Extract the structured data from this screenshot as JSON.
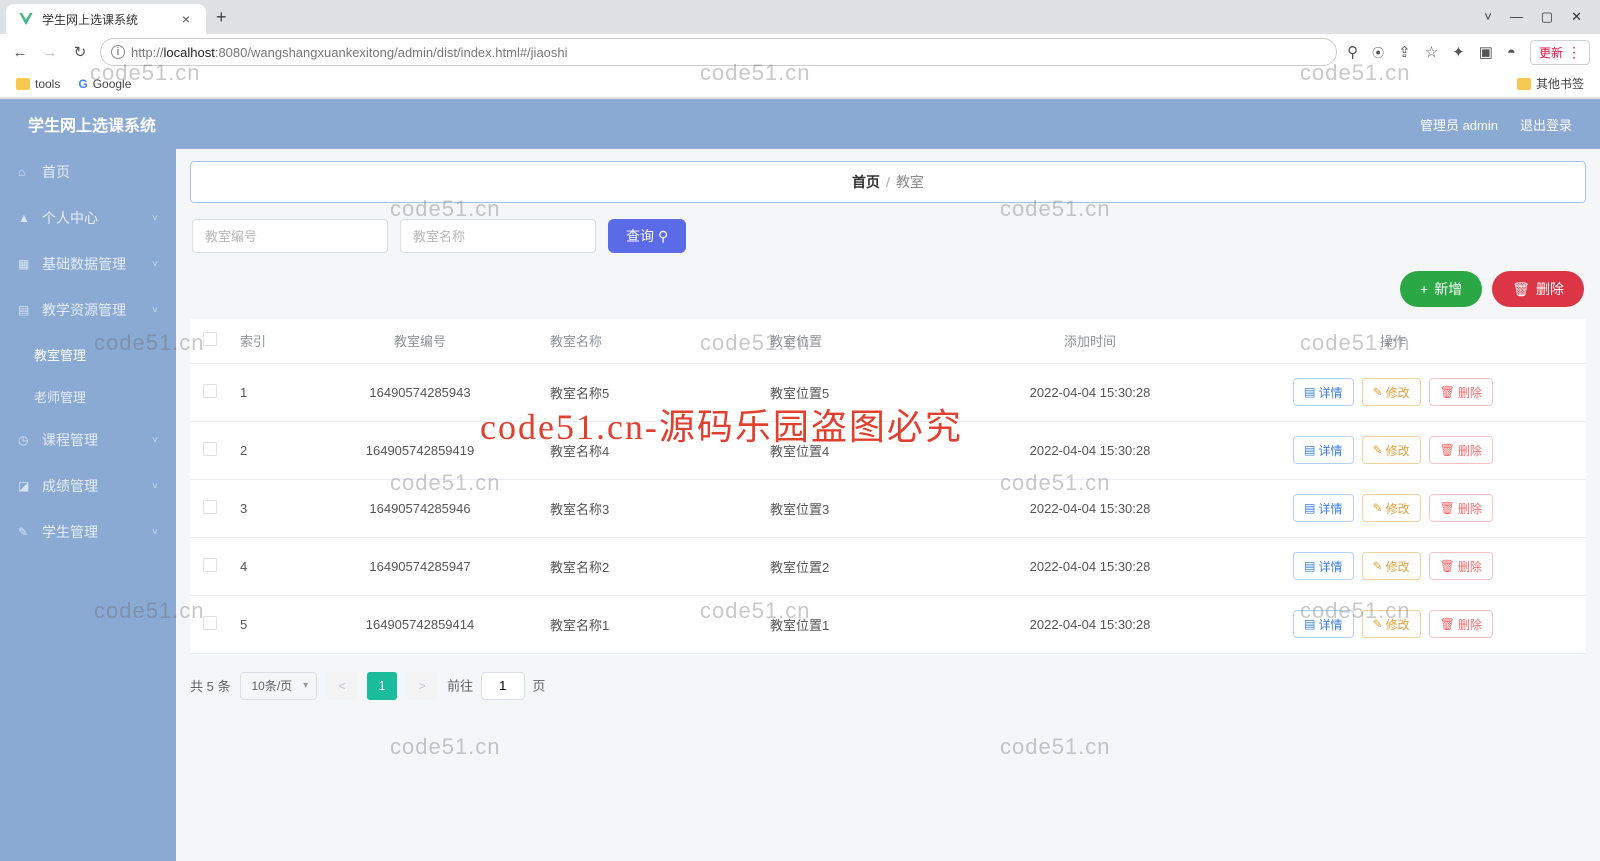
{
  "browser": {
    "tab_title": "学生网上选课系统",
    "url_host": "localhost",
    "url_port": ":8080",
    "url_prefix": "http://",
    "url_path": "/wangshangxuankexitong/admin/dist/index.html#/jiaoshi",
    "update_label": "更新",
    "bookmarks": {
      "tools": "tools",
      "google": "Google",
      "other": "其他书签"
    }
  },
  "app": {
    "title": "学生网上选课系统",
    "user": "管理员 admin",
    "logout": "退出登录"
  },
  "sidebar": {
    "home": "首页",
    "personal": "个人中心",
    "base_data": "基础数据管理",
    "teach_res": "教学资源管理",
    "classroom": "教室管理",
    "teacher": "老师管理",
    "course": "课程管理",
    "grade": "成绩管理",
    "student": "学生管理"
  },
  "breadcrumb": {
    "home": "首页",
    "current": "教室"
  },
  "search": {
    "ph_code": "教室编号",
    "ph_name": "教室名称",
    "query": "查询"
  },
  "actions": {
    "add": "新增",
    "delete": "删除"
  },
  "table": {
    "headers": {
      "index": "索引",
      "code": "教室编号",
      "name": "教室名称",
      "loc": "教室位置",
      "time": "添加时间",
      "op": "操作"
    },
    "ops": {
      "view": "详情",
      "edit": "修改",
      "del": "删除"
    },
    "rows": [
      {
        "idx": "1",
        "code": "16490574285943",
        "name": "教室名称5",
        "loc": "教室位置5",
        "time": "2022-04-04 15:30:28"
      },
      {
        "idx": "2",
        "code": "164905742859419",
        "name": "教室名称4",
        "loc": "教室位置4",
        "time": "2022-04-04 15:30:28"
      },
      {
        "idx": "3",
        "code": "16490574285946",
        "name": "教室名称3",
        "loc": "教室位置3",
        "time": "2022-04-04 15:30:28"
      },
      {
        "idx": "4",
        "code": "16490574285947",
        "name": "教室名称2",
        "loc": "教室位置2",
        "time": "2022-04-04 15:30:28"
      },
      {
        "idx": "5",
        "code": "164905742859414",
        "name": "教室名称1",
        "loc": "教室位置1",
        "time": "2022-04-04 15:30:28"
      }
    ]
  },
  "pager": {
    "total": "共 5 条",
    "per_page": "10条/页",
    "current": "1",
    "goto_prefix": "前往",
    "goto_suffix": "页",
    "goto_val": "1"
  },
  "watermark": {
    "small": "code51.cn",
    "big": "code51.cn-源码乐园盗图必究"
  }
}
